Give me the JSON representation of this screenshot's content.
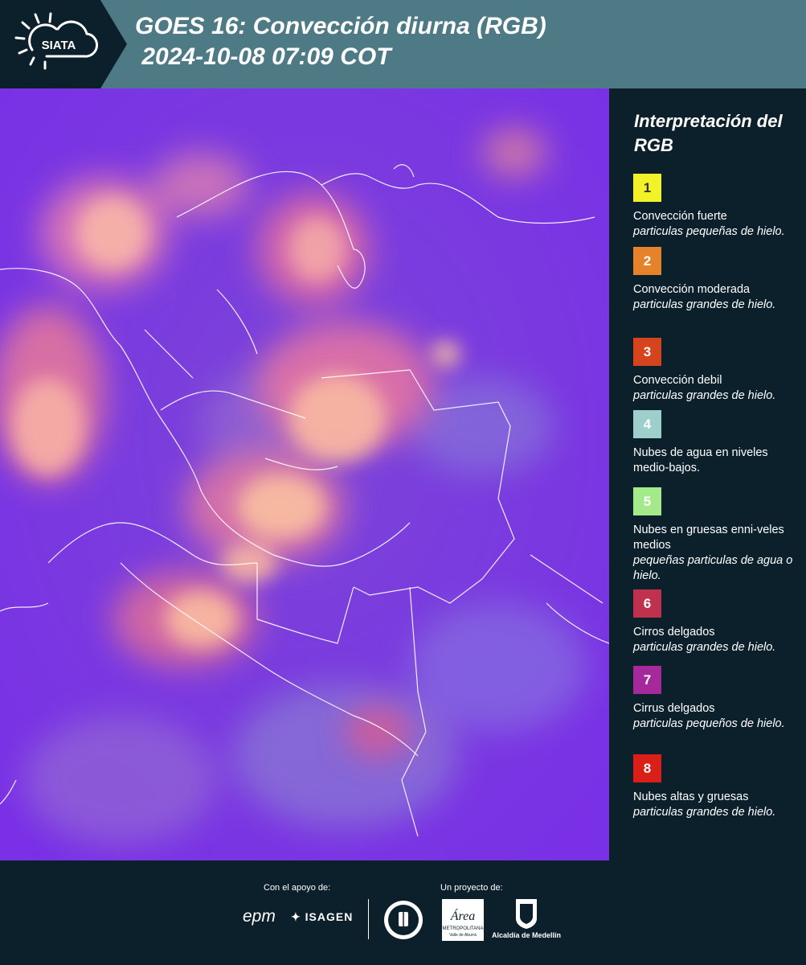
{
  "header": {
    "logo_text": "SIATA",
    "title_line1": "GOES 16: Convección diurna (RGB)",
    "title_line2": " 2024-10-08 07:09 COT",
    "background_color": "#4e7a86",
    "logo_block_color": "#0c202c"
  },
  "map": {
    "description": "satellite-image",
    "base_color": "#7a3ae0"
  },
  "legend": {
    "title": "Interpretación del RGB",
    "items": [
      {
        "number": "1",
        "color": "#f1f227",
        "text_color": "#333333",
        "label": "Convección fuerte",
        "sub": "particulas pequeñas de hielo."
      },
      {
        "number": "2",
        "color": "#e5822a",
        "text_color": "#ffffff",
        "label": "Convección moderada",
        "sub": "particulas grandes de hielo."
      },
      {
        "number": "3",
        "color": "#d6441d",
        "text_color": "#ffffff",
        "label": "Convección debil",
        "sub": "particulas grandes de hielo."
      },
      {
        "number": "4",
        "color": "#9fcfcb",
        "text_color": "#ffffff",
        "label": "Nubes de agua en niveles medio-bajos.",
        "sub": ""
      },
      {
        "number": "5",
        "color": "#a4ea8b",
        "text_color": "#ffffff",
        "label": "Nubes en gruesas enni-veles medios",
        "sub": "pequeñas particulas de agua o hielo."
      },
      {
        "number": "6",
        "color": "#c0314e",
        "text_color": "#ffffff",
        "label": "Cirros delgados",
        "sub": "particulas grandes de hielo."
      },
      {
        "number": "7",
        "color": "#a5299b",
        "text_color": "#ffffff",
        "label": "Cirrus delgados",
        "sub": "particulas pequeños de hielo."
      },
      {
        "number": "8",
        "color": "#d91f17",
        "text_color": "#ffffff",
        "label": "Nubes altas y gruesas",
        "sub": "particulas grandes de hielo."
      }
    ]
  },
  "footer": {
    "support_label": "Con el apoyo de:",
    "project_label": "Un proyecto de:",
    "epm_logo": "epm",
    "isagen_logo": "ISAGEN",
    "area_logo": "Área",
    "area_sub1": "METROPOLITANA",
    "area_sub2": "Valle de Aburrá",
    "alcaldia_label": "Alcaldía de Medellín"
  }
}
